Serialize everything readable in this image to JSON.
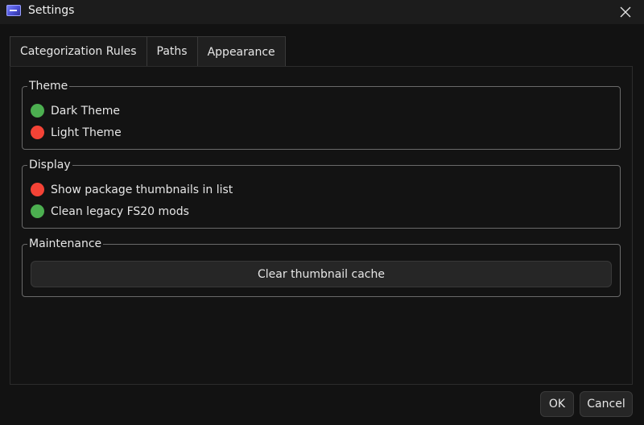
{
  "window": {
    "title": "Settings",
    "app_icon": "app-window-icon",
    "close_icon": "close-icon"
  },
  "tabs": [
    {
      "label": "Categorization Rules",
      "active": false
    },
    {
      "label": "Paths",
      "active": false
    },
    {
      "label": "Appearance",
      "active": true
    }
  ],
  "theme": {
    "title": "Theme",
    "options": [
      {
        "label": "Dark Theme",
        "color": "#4caf50"
      },
      {
        "label": "Light Theme",
        "color": "#f44336"
      }
    ]
  },
  "display": {
    "title": "Display",
    "options": [
      {
        "label": "Show package thumbnails in list",
        "color": "#f44336"
      },
      {
        "label": "Clean legacy FS20 mods",
        "color": "#4caf50"
      }
    ]
  },
  "maintenance": {
    "title": "Maintenance",
    "clear_cache_label": "Clear thumbnail cache"
  },
  "footer": {
    "ok_label": "OK",
    "cancel_label": "Cancel"
  }
}
